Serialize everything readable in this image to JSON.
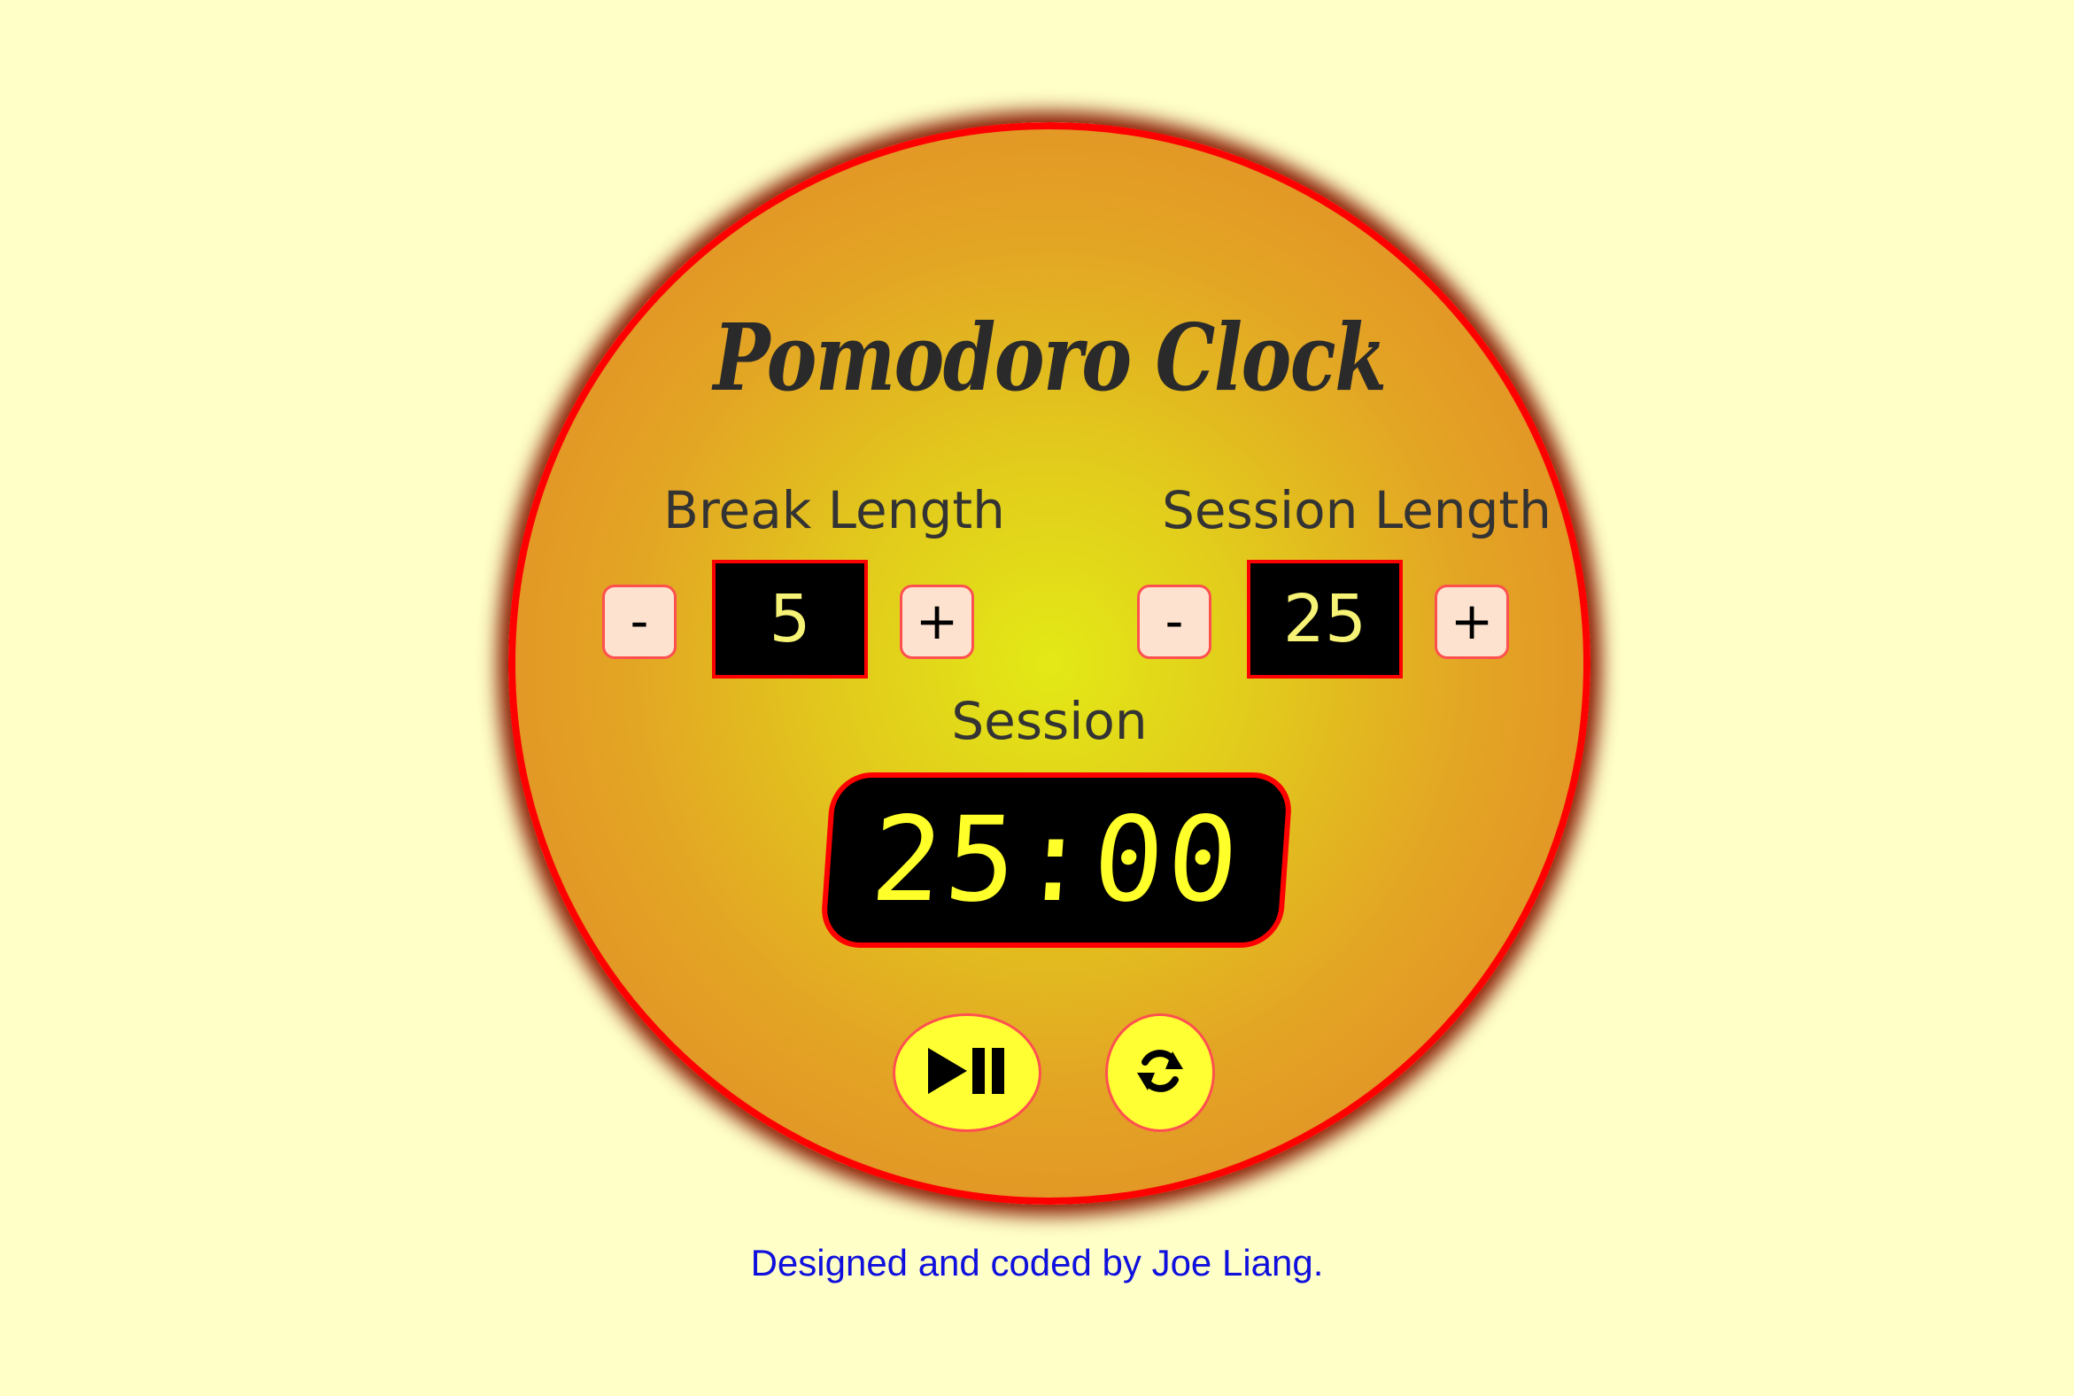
{
  "app": {
    "title": "Pomodoro Clock"
  },
  "break": {
    "label": "Break Length",
    "value": "5",
    "decrement_label": "-",
    "increment_label": "+"
  },
  "session": {
    "label": "Session Length",
    "value": "25",
    "decrement_label": "-",
    "increment_label": "+"
  },
  "timer": {
    "label": "Session",
    "time": "25:00"
  },
  "controls": {
    "play_pause_icon": "play-pause-icon",
    "reset_icon": "refresh-icon"
  },
  "footer": {
    "credit": "Designed and coded by Joe Liang."
  },
  "colors": {
    "background": "#ffffc8",
    "face_ring": "#ff0000",
    "display_text": "#ffff2a",
    "value_text": "#f6f276",
    "control_button": "#ffff33",
    "small_button": "#fde3cf",
    "footer_text": "#1010dd"
  }
}
